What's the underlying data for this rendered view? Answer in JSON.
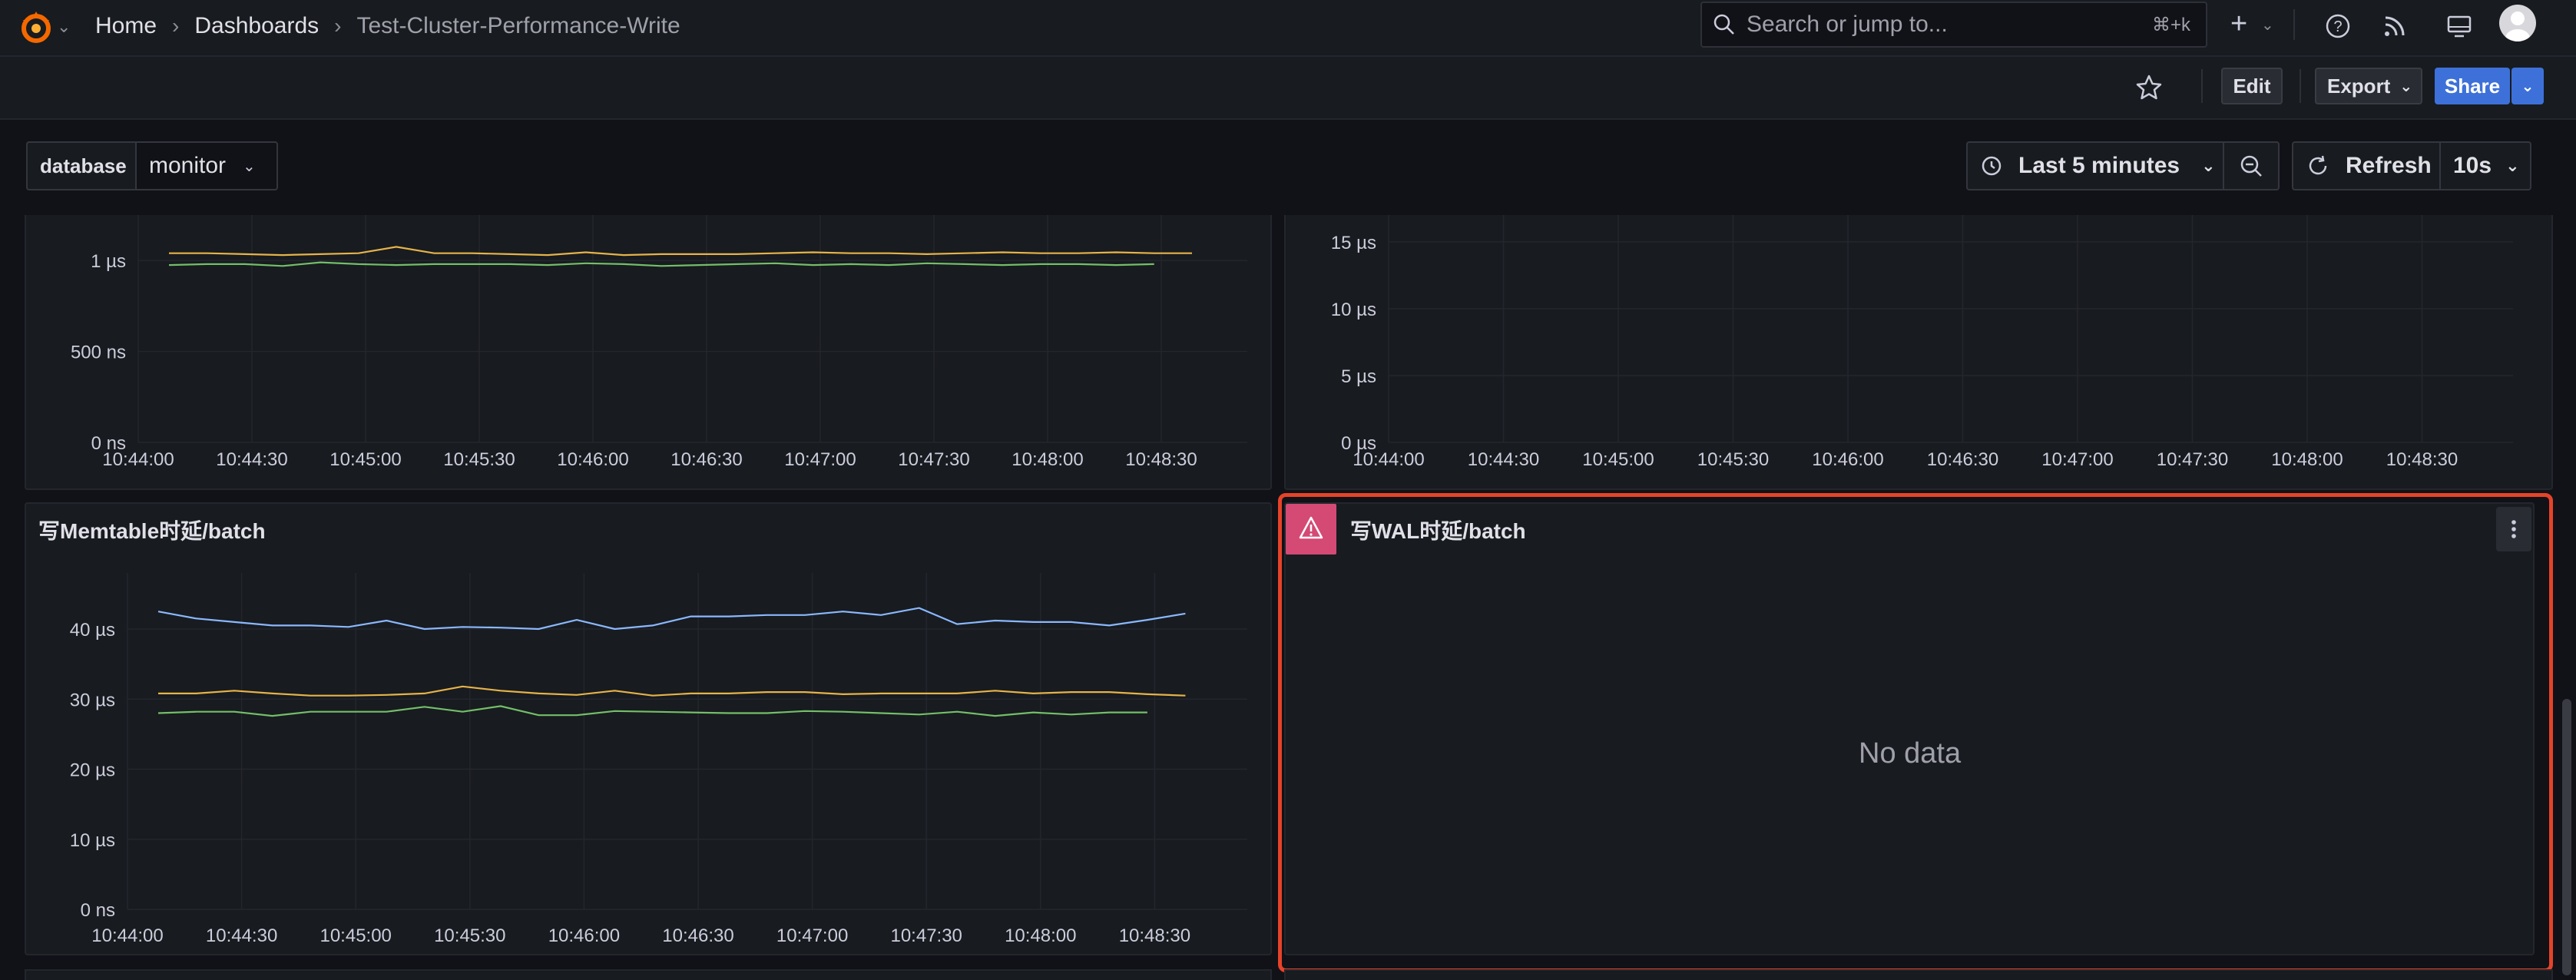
{
  "breadcrumb": {
    "home": "Home",
    "dashboards": "Dashboards",
    "current": "Test-Cluster-Performance-Write"
  },
  "search": {
    "placeholder": "Search or jump to...",
    "shortcut": "⌘+k"
  },
  "toolbar": {
    "edit": "Edit",
    "export": "Export",
    "share": "Share"
  },
  "variables": {
    "label": "database",
    "value": "monitor"
  },
  "time_picker": {
    "range": "Last 5 minutes",
    "refresh": "Refresh",
    "interval": "10s"
  },
  "panels": {
    "top_left": {
      "title": ""
    },
    "top_right": {
      "title": ""
    },
    "memtable": {
      "title": "写Memtable时延/batch"
    },
    "wal": {
      "title": "写WAL时延/batch",
      "message": "No data"
    }
  },
  "colors": {
    "yellow": "#e5b34a",
    "green": "#73bf69",
    "blue": "#8ab8ff",
    "accent": "#3d71d9",
    "error": "#d44a75",
    "highlight": "#e5432a"
  },
  "icons": {
    "logo": "grafana-logo-icon",
    "search": "search-icon",
    "help": "help-icon",
    "news": "rss-icon",
    "kiosk": "monitor-icon",
    "star": "star-icon",
    "clock": "clock-icon",
    "zoom_out": "zoom-out-icon",
    "refresh": "refresh-icon",
    "warning": "warning-icon",
    "menu": "vertical-ellipsis-icon"
  },
  "chart_data": [
    {
      "type": "line",
      "title": "",
      "x": [
        "10:44:00",
        "10:44:30",
        "10:45:00",
        "10:45:30",
        "10:46:00",
        "10:46:30",
        "10:47:00",
        "10:47:30",
        "10:48:00",
        "10:48:30"
      ],
      "y_ticks": [
        "0 ns",
        "500 ns",
        "1 µs"
      ],
      "y_unit": "ns",
      "ylim": [
        0,
        1250
      ],
      "series": [
        {
          "color": "#e5b34a",
          "values": [
            1040,
            1040,
            1035,
            1030,
            1035,
            1040,
            1075,
            1040,
            1040,
            1035,
            1030,
            1045,
            1030,
            1035,
            1035,
            1035,
            1040,
            1045,
            1040,
            1040,
            1035,
            1040,
            1045,
            1040,
            1040,
            1045,
            1040,
            1040
          ]
        },
        {
          "color": "#73bf69",
          "values": [
            975,
            980,
            980,
            970,
            990,
            980,
            975,
            980,
            980,
            980,
            975,
            985,
            980,
            970,
            975,
            980,
            985,
            975,
            980,
            975,
            985,
            980,
            975,
            980,
            980,
            975,
            980
          ]
        }
      ]
    },
    {
      "type": "line",
      "title": "",
      "x": [
        "10:44:00",
        "10:44:30",
        "10:45:00",
        "10:45:30",
        "10:46:00",
        "10:46:30",
        "10:47:00",
        "10:47:30",
        "10:48:00",
        "10:48:30"
      ],
      "y_ticks": [
        "0 µs",
        "5 µs",
        "10 µs",
        "15 µs"
      ],
      "y_unit": "µs",
      "ylim": [
        0,
        17
      ]
    },
    {
      "type": "line",
      "title": "写Memtable时延/batch",
      "x": [
        "10:44:00",
        "10:44:30",
        "10:45:00",
        "10:45:30",
        "10:46:00",
        "10:46:30",
        "10:47:00",
        "10:47:30",
        "10:48:00",
        "10:48:30"
      ],
      "y_ticks": [
        "0 ns",
        "10 µs",
        "20 µs",
        "30 µs",
        "40 µs"
      ],
      "y_unit": "µs",
      "ylim": [
        0,
        48
      ],
      "series": [
        {
          "color": "#8ab8ff",
          "values": [
            42.5,
            41.5,
            41,
            40.5,
            40.5,
            40.3,
            41.2,
            40,
            40.3,
            40.2,
            40,
            41.3,
            40,
            40.5,
            41.8,
            41.8,
            42,
            42,
            42.5,
            42,
            43,
            40.7,
            41.2,
            41,
            41,
            40.5,
            41.3,
            42.2
          ]
        },
        {
          "color": "#e5b34a",
          "values": [
            30.8,
            30.8,
            31.2,
            30.8,
            30.5,
            30.5,
            30.6,
            30.8,
            31.8,
            31.2,
            30.8,
            30.6,
            31.2,
            30.5,
            30.8,
            30.8,
            31,
            31,
            30.7,
            30.8,
            30.8,
            30.8,
            31.2,
            30.8,
            31,
            31,
            30.7,
            30.5
          ]
        },
        {
          "color": "#73bf69",
          "values": [
            28,
            28.2,
            28.2,
            27.6,
            28.2,
            28.2,
            28.2,
            28.9,
            28.2,
            29,
            27.7,
            27.7,
            28.3,
            28.2,
            28.1,
            28,
            28,
            28.3,
            28.2,
            28,
            27.8,
            28.2,
            27.6,
            28.1,
            27.8,
            28.1,
            28.1
          ]
        }
      ]
    },
    {
      "type": "line",
      "title": "写WAL时延/batch",
      "series": []
    }
  ]
}
